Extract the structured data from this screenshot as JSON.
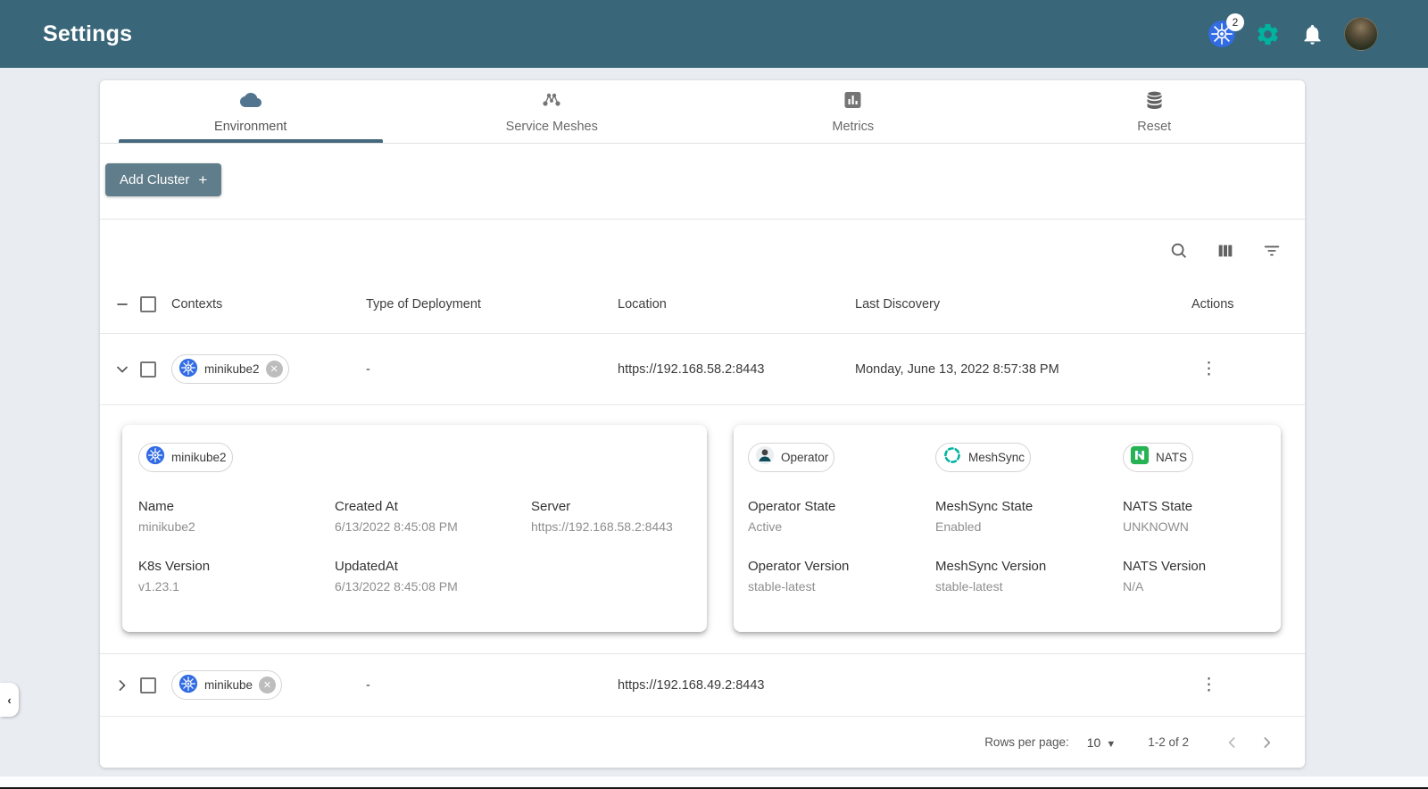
{
  "colors": {
    "header_bg": "#396679",
    "accent_green": "#00B39F",
    "k8s_blue": "#326CE5",
    "add_button_bg": "#607d8b"
  },
  "header": {
    "title": "Settings",
    "k8s_badge": "2"
  },
  "tabs": [
    {
      "label": "Environment"
    },
    {
      "label": "Service Meshes"
    },
    {
      "label": "Metrics"
    },
    {
      "label": "Reset"
    }
  ],
  "toolbar": {
    "add_cluster": "Add Cluster",
    "plus": "+"
  },
  "table": {
    "headers": {
      "contexts": "Contexts",
      "type": "Type of Deployment",
      "location": "Location",
      "last_discovery": "Last Discovery",
      "actions": "Actions"
    },
    "rows": [
      {
        "context": "minikube2",
        "type": "-",
        "location": "https://192.168.58.2:8443",
        "last_discovery": "Monday, June 13, 2022 8:57:38 PM"
      },
      {
        "context": "minikube",
        "type": "-",
        "location": "https://192.168.49.2:8443",
        "last_discovery": ""
      }
    ]
  },
  "detail": {
    "cluster_chip": "minikube2",
    "left": {
      "fields": [
        {
          "label": "Name",
          "value": "minikube2"
        },
        {
          "label": "Created At",
          "value": "6/13/2022 8:45:08 PM"
        },
        {
          "label": "Server",
          "value": "https://192.168.58.2:8443"
        },
        {
          "label": "K8s Version",
          "value": "v1.23.1"
        },
        {
          "label": "UpdatedAt",
          "value": "6/13/2022 8:45:08 PM"
        }
      ]
    },
    "right": {
      "chips": [
        {
          "label": "Operator"
        },
        {
          "label": "MeshSync"
        },
        {
          "label": "NATS"
        }
      ],
      "fields": [
        {
          "label": "Operator State",
          "value": "Active"
        },
        {
          "label": "MeshSync State",
          "value": "Enabled"
        },
        {
          "label": "NATS State",
          "value": "UNKNOWN"
        },
        {
          "label": "Operator Version",
          "value": "stable-latest"
        },
        {
          "label": "MeshSync Version",
          "value": "stable-latest"
        },
        {
          "label": "NATS Version",
          "value": "N/A"
        }
      ]
    }
  },
  "pagination": {
    "rows_per_page_label": "Rows per page:",
    "rows_per_page_value": "10",
    "range": "1-2 of 2"
  }
}
